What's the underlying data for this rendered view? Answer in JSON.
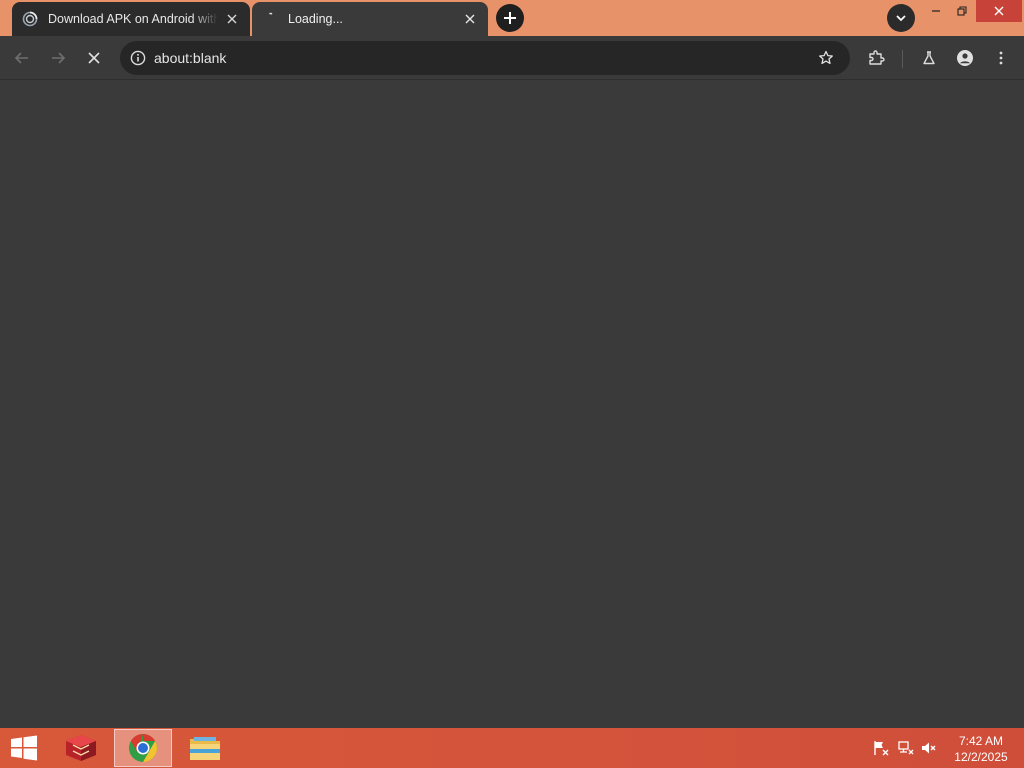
{
  "tabs": [
    {
      "title": "Download APK on Android with",
      "active": false
    },
    {
      "title": "Loading...",
      "active": true
    }
  ],
  "toolbar": {
    "url": "about:blank"
  },
  "taskbar": {
    "apps": [
      {
        "name": "game-app-icon",
        "active": false
      },
      {
        "name": "chrome-icon",
        "active": true
      },
      {
        "name": "file-explorer-icon",
        "active": false
      }
    ],
    "time": "7:42 AM",
    "date": "12/2/2025"
  },
  "colors": {
    "tabstrip": "#e8926a",
    "content": "#3a3a3a",
    "taskbar": "#d4543b"
  }
}
